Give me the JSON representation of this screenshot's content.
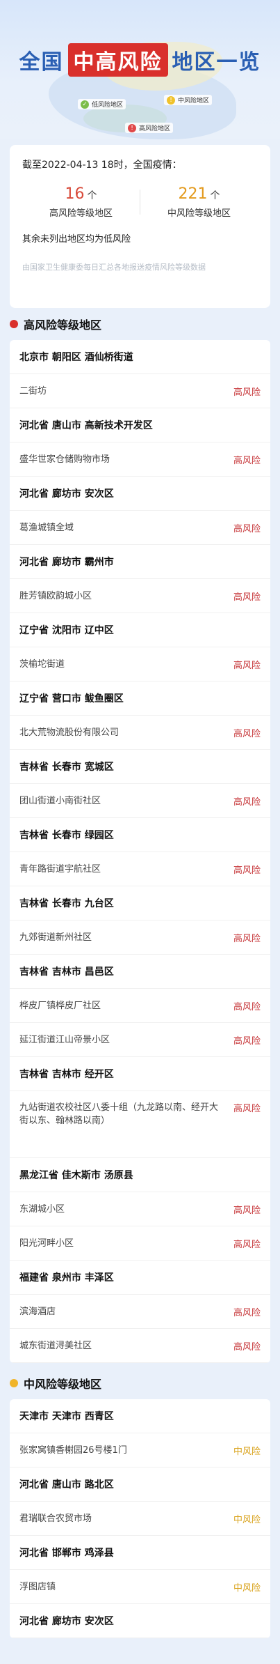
{
  "header": {
    "title_left": "全国",
    "title_highlight": "中高风险",
    "title_right": "地区一览",
    "legend": {
      "low": "低风险地区",
      "mid": "中风险地区",
      "high": "高风险地区"
    }
  },
  "summary": {
    "date_text": "截至2022-04-13 18时，全国疫情：",
    "high_count": "16",
    "high_unit": "个",
    "high_label": "高风险等级地区",
    "mid_count": "221",
    "mid_unit": "个",
    "mid_label": "中风险等级地区",
    "rest_text": "其余未列出地区均为低风险",
    "source_text": "由国家卫生健康委每日汇总各地报送疫情风险等级数据"
  },
  "high_section": {
    "label": "高风险等级地区",
    "color": "#d9302c",
    "rows": [
      {
        "type": "region",
        "text": "北京市 朝阳区 酒仙桥街道"
      },
      {
        "type": "loc",
        "text": "二街坊",
        "tag": "高风险"
      },
      {
        "type": "region",
        "text": "河北省 唐山市 高新技术开发区"
      },
      {
        "type": "loc",
        "text": "盛华世家仓储购物市场",
        "tag": "高风险"
      },
      {
        "type": "region",
        "text": "河北省 廊坊市 安次区"
      },
      {
        "type": "loc",
        "text": "葛渔城镇全域",
        "tag": "高风险"
      },
      {
        "type": "region",
        "text": "河北省 廊坊市 霸州市"
      },
      {
        "type": "loc",
        "text": "胜芳镇欧韵城小区",
        "tag": "高风险"
      },
      {
        "type": "region",
        "text": "辽宁省 沈阳市 辽中区"
      },
      {
        "type": "loc",
        "text": "茨榆坨街道",
        "tag": "高风险"
      },
      {
        "type": "region",
        "text": "辽宁省 营口市 鲅鱼圈区"
      },
      {
        "type": "loc",
        "text": "北大荒物流股份有限公司",
        "tag": "高风险"
      },
      {
        "type": "region",
        "text": "吉林省 长春市 宽城区"
      },
      {
        "type": "loc",
        "text": "团山街道小南街社区",
        "tag": "高风险"
      },
      {
        "type": "region",
        "text": "吉林省 长春市 绿园区"
      },
      {
        "type": "loc",
        "text": "青年路街道宇航社区",
        "tag": "高风险"
      },
      {
        "type": "region",
        "text": "吉林省 长春市 九台区"
      },
      {
        "type": "loc",
        "text": "九郊街道新州社区",
        "tag": "高风险"
      },
      {
        "type": "region",
        "text": "吉林省 吉林市 昌邑区"
      },
      {
        "type": "loc",
        "text": "桦皮厂镇桦皮厂社区",
        "tag": "高风险"
      },
      {
        "type": "loc",
        "text": "延江街道江山帝景小区",
        "tag": "高风险"
      },
      {
        "type": "region",
        "text": "吉林省 吉林市 经开区"
      },
      {
        "type": "loc",
        "text": "九站街道农校社区八委十组（九龙路以南、经开大街以东、翰林路以南）",
        "tag": "高风险",
        "tall": true
      },
      {
        "type": "region",
        "text": "黑龙江省 佳木斯市 汤原县"
      },
      {
        "type": "loc",
        "text": "东湖城小区",
        "tag": "高风险"
      },
      {
        "type": "loc",
        "text": "阳光河畔小区",
        "tag": "高风险"
      },
      {
        "type": "region",
        "text": "福建省 泉州市 丰泽区"
      },
      {
        "type": "loc",
        "text": "滨海酒店",
        "tag": "高风险"
      },
      {
        "type": "loc",
        "text": "城东街道浔美社区",
        "tag": "高风险"
      }
    ]
  },
  "mid_section": {
    "label": "中风险等级地区",
    "color": "#f0b429",
    "rows": [
      {
        "type": "region",
        "text": "天津市 天津市 西青区"
      },
      {
        "type": "loc",
        "text": "张家窝镇香榭园26号楼1门",
        "tag": "中风险"
      },
      {
        "type": "region",
        "text": "河北省 唐山市 路北区"
      },
      {
        "type": "loc",
        "text": "君瑞联合农贸市场",
        "tag": "中风险"
      },
      {
        "type": "region",
        "text": "河北省 邯郸市 鸡泽县"
      },
      {
        "type": "loc",
        "text": "浮图店镇",
        "tag": "中风险"
      },
      {
        "type": "region",
        "text": "河北省 廊坊市 安次区"
      }
    ]
  }
}
